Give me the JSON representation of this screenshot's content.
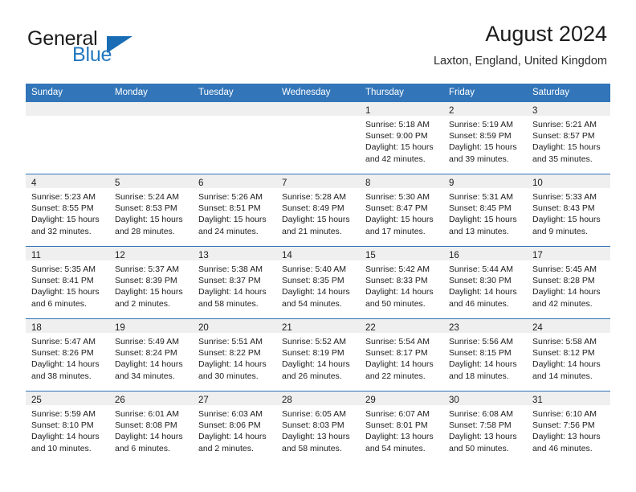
{
  "brand": {
    "name_part1": "General",
    "name_part2": "Blue",
    "flag_color": "#1a6db5"
  },
  "header": {
    "title": "August 2024",
    "subtitle": "Laxton, England, United Kingdom"
  },
  "theme": {
    "header_blue": "#3275b8",
    "day_band_gray": "#efefef",
    "text": "#1d1d1d"
  },
  "labels": {
    "sunrise_prefix": "Sunrise:",
    "sunset_prefix": "Sunset:",
    "daylight_prefix": "Daylight:"
  },
  "weekdays": [
    "Sunday",
    "Monday",
    "Tuesday",
    "Wednesday",
    "Thursday",
    "Friday",
    "Saturday"
  ],
  "weeks": [
    [
      {
        "day": "",
        "empty": true,
        "line1": "",
        "line2": "",
        "line3": "",
        "line4": ""
      },
      {
        "day": "",
        "empty": true,
        "line1": "",
        "line2": "",
        "line3": "",
        "line4": ""
      },
      {
        "day": "",
        "empty": true,
        "line1": "",
        "line2": "",
        "line3": "",
        "line4": ""
      },
      {
        "day": "",
        "empty": true,
        "line1": "",
        "line2": "",
        "line3": "",
        "line4": ""
      },
      {
        "day": "1",
        "empty": false,
        "line1": "Sunrise: 5:18 AM",
        "line2": "Sunset: 9:00 PM",
        "line3": "Daylight: 15 hours",
        "line4": "and 42 minutes."
      },
      {
        "day": "2",
        "empty": false,
        "line1": "Sunrise: 5:19 AM",
        "line2": "Sunset: 8:59 PM",
        "line3": "Daylight: 15 hours",
        "line4": "and 39 minutes."
      },
      {
        "day": "3",
        "empty": false,
        "line1": "Sunrise: 5:21 AM",
        "line2": "Sunset: 8:57 PM",
        "line3": "Daylight: 15 hours",
        "line4": "and 35 minutes."
      }
    ],
    [
      {
        "day": "4",
        "empty": false,
        "line1": "Sunrise: 5:23 AM",
        "line2": "Sunset: 8:55 PM",
        "line3": "Daylight: 15 hours",
        "line4": "and 32 minutes."
      },
      {
        "day": "5",
        "empty": false,
        "line1": "Sunrise: 5:24 AM",
        "line2": "Sunset: 8:53 PM",
        "line3": "Daylight: 15 hours",
        "line4": "and 28 minutes."
      },
      {
        "day": "6",
        "empty": false,
        "line1": "Sunrise: 5:26 AM",
        "line2": "Sunset: 8:51 PM",
        "line3": "Daylight: 15 hours",
        "line4": "and 24 minutes."
      },
      {
        "day": "7",
        "empty": false,
        "line1": "Sunrise: 5:28 AM",
        "line2": "Sunset: 8:49 PM",
        "line3": "Daylight: 15 hours",
        "line4": "and 21 minutes."
      },
      {
        "day": "8",
        "empty": false,
        "line1": "Sunrise: 5:30 AM",
        "line2": "Sunset: 8:47 PM",
        "line3": "Daylight: 15 hours",
        "line4": "and 17 minutes."
      },
      {
        "day": "9",
        "empty": false,
        "line1": "Sunrise: 5:31 AM",
        "line2": "Sunset: 8:45 PM",
        "line3": "Daylight: 15 hours",
        "line4": "and 13 minutes."
      },
      {
        "day": "10",
        "empty": false,
        "line1": "Sunrise: 5:33 AM",
        "line2": "Sunset: 8:43 PM",
        "line3": "Daylight: 15 hours",
        "line4": "and 9 minutes."
      }
    ],
    [
      {
        "day": "11",
        "empty": false,
        "line1": "Sunrise: 5:35 AM",
        "line2": "Sunset: 8:41 PM",
        "line3": "Daylight: 15 hours",
        "line4": "and 6 minutes."
      },
      {
        "day": "12",
        "empty": false,
        "line1": "Sunrise: 5:37 AM",
        "line2": "Sunset: 8:39 PM",
        "line3": "Daylight: 15 hours",
        "line4": "and 2 minutes."
      },
      {
        "day": "13",
        "empty": false,
        "line1": "Sunrise: 5:38 AM",
        "line2": "Sunset: 8:37 PM",
        "line3": "Daylight: 14 hours",
        "line4": "and 58 minutes."
      },
      {
        "day": "14",
        "empty": false,
        "line1": "Sunrise: 5:40 AM",
        "line2": "Sunset: 8:35 PM",
        "line3": "Daylight: 14 hours",
        "line4": "and 54 minutes."
      },
      {
        "day": "15",
        "empty": false,
        "line1": "Sunrise: 5:42 AM",
        "line2": "Sunset: 8:33 PM",
        "line3": "Daylight: 14 hours",
        "line4": "and 50 minutes."
      },
      {
        "day": "16",
        "empty": false,
        "line1": "Sunrise: 5:44 AM",
        "line2": "Sunset: 8:30 PM",
        "line3": "Daylight: 14 hours",
        "line4": "and 46 minutes."
      },
      {
        "day": "17",
        "empty": false,
        "line1": "Sunrise: 5:45 AM",
        "line2": "Sunset: 8:28 PM",
        "line3": "Daylight: 14 hours",
        "line4": "and 42 minutes."
      }
    ],
    [
      {
        "day": "18",
        "empty": false,
        "line1": "Sunrise: 5:47 AM",
        "line2": "Sunset: 8:26 PM",
        "line3": "Daylight: 14 hours",
        "line4": "and 38 minutes."
      },
      {
        "day": "19",
        "empty": false,
        "line1": "Sunrise: 5:49 AM",
        "line2": "Sunset: 8:24 PM",
        "line3": "Daylight: 14 hours",
        "line4": "and 34 minutes."
      },
      {
        "day": "20",
        "empty": false,
        "line1": "Sunrise: 5:51 AM",
        "line2": "Sunset: 8:22 PM",
        "line3": "Daylight: 14 hours",
        "line4": "and 30 minutes."
      },
      {
        "day": "21",
        "empty": false,
        "line1": "Sunrise: 5:52 AM",
        "line2": "Sunset: 8:19 PM",
        "line3": "Daylight: 14 hours",
        "line4": "and 26 minutes."
      },
      {
        "day": "22",
        "empty": false,
        "line1": "Sunrise: 5:54 AM",
        "line2": "Sunset: 8:17 PM",
        "line3": "Daylight: 14 hours",
        "line4": "and 22 minutes."
      },
      {
        "day": "23",
        "empty": false,
        "line1": "Sunrise: 5:56 AM",
        "line2": "Sunset: 8:15 PM",
        "line3": "Daylight: 14 hours",
        "line4": "and 18 minutes."
      },
      {
        "day": "24",
        "empty": false,
        "line1": "Sunrise: 5:58 AM",
        "line2": "Sunset: 8:12 PM",
        "line3": "Daylight: 14 hours",
        "line4": "and 14 minutes."
      }
    ],
    [
      {
        "day": "25",
        "empty": false,
        "line1": "Sunrise: 5:59 AM",
        "line2": "Sunset: 8:10 PM",
        "line3": "Daylight: 14 hours",
        "line4": "and 10 minutes."
      },
      {
        "day": "26",
        "empty": false,
        "line1": "Sunrise: 6:01 AM",
        "line2": "Sunset: 8:08 PM",
        "line3": "Daylight: 14 hours",
        "line4": "and 6 minutes."
      },
      {
        "day": "27",
        "empty": false,
        "line1": "Sunrise: 6:03 AM",
        "line2": "Sunset: 8:06 PM",
        "line3": "Daylight: 14 hours",
        "line4": "and 2 minutes."
      },
      {
        "day": "28",
        "empty": false,
        "line1": "Sunrise: 6:05 AM",
        "line2": "Sunset: 8:03 PM",
        "line3": "Daylight: 13 hours",
        "line4": "and 58 minutes."
      },
      {
        "day": "29",
        "empty": false,
        "line1": "Sunrise: 6:07 AM",
        "line2": "Sunset: 8:01 PM",
        "line3": "Daylight: 13 hours",
        "line4": "and 54 minutes."
      },
      {
        "day": "30",
        "empty": false,
        "line1": "Sunrise: 6:08 AM",
        "line2": "Sunset: 7:58 PM",
        "line3": "Daylight: 13 hours",
        "line4": "and 50 minutes."
      },
      {
        "day": "31",
        "empty": false,
        "line1": "Sunrise: 6:10 AM",
        "line2": "Sunset: 7:56 PM",
        "line3": "Daylight: 13 hours",
        "line4": "and 46 minutes."
      }
    ]
  ]
}
